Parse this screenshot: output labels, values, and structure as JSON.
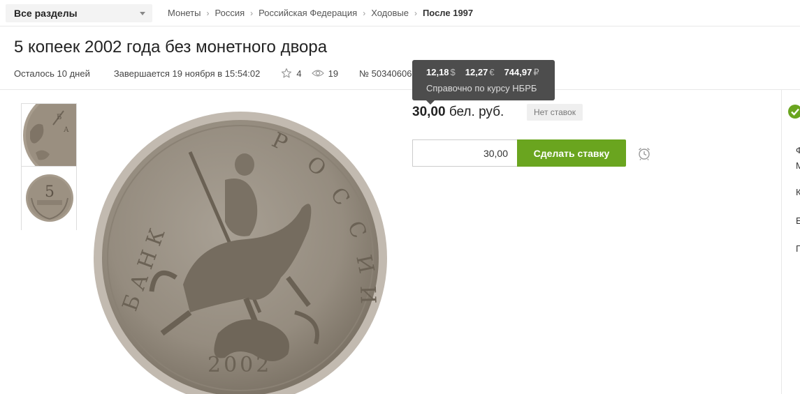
{
  "header": {
    "sections_label": "Все разделы",
    "breadcrumbs": [
      "Монеты",
      "Россия",
      "Российская Федерация",
      "Ходовые",
      "После 1997"
    ]
  },
  "lot": {
    "title": "5 копеек 2002 года без монетного двора",
    "remaining": "Осталось  10 дней",
    "ends": "Завершается 19 ноября в 15:54:02",
    "favorites": "4",
    "views": "19",
    "lot_number": "№ 503406062"
  },
  "tooltip": {
    "usd": "12,18",
    "usd_sign": "$",
    "eur": "12,27",
    "eur_sign": "€",
    "rub": "744,97",
    "rub_sign": "₽",
    "note": "Справочно по курсу НБРБ"
  },
  "price": {
    "amount": "30,00",
    "currency": "бел. руб.",
    "no_bids": "Нет ставок"
  },
  "bid": {
    "input_value": "30,00",
    "button_label": "Сделать ставку"
  },
  "right_column": {
    "letters": [
      "Ф",
      "М",
      "К",
      "Е",
      "Г"
    ]
  },
  "colors": {
    "accent_green": "#6aa51f",
    "tooltip_bg": "#4d4d4d"
  }
}
